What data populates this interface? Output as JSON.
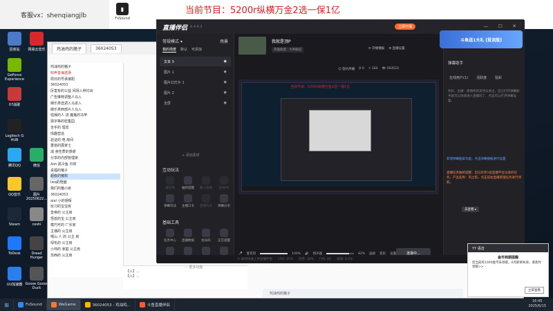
{
  "banner": {
    "wx": "客服vx：shenqiangjlb",
    "fxsound": "FxSound",
    "title": "当前节目：5200r纵横万金2选一保1亿"
  },
  "desktop_icons": [
    {
      "label": "回收站",
      "color": "#4a7ac8"
    },
    {
      "label": "网易云音乐",
      "color": "#d8282c"
    },
    {
      "label": "GeForce Experience",
      "color": "#76b900"
    },
    {
      "label": "07战歌",
      "color": "#c83a3a"
    },
    {
      "label": "Logitech G HUB",
      "color": "#222"
    },
    {
      "label": "腾讯QQ",
      "color": "#2aa8f2"
    },
    {
      "label": "QQ音乐",
      "color": "#f7c72b"
    },
    {
      "label": "Steam",
      "color": "#1b2838"
    },
    {
      "label": "ToDesk",
      "color": "#1e78ff"
    },
    {
      "label": "UU加速器",
      "color": "#2a7ff0"
    },
    {
      "label": "Dread Hunger",
      "color": "#444"
    },
    {
      "label": "Goose Goose Duck",
      "color": "#555"
    },
    {
      "label": "微信",
      "color": "#2aae67"
    },
    {
      "label": "ceshi",
      "color": "#888"
    },
    {
      "label": "图片 20250622...",
      "color": "#666"
    }
  ],
  "browser": {
    "tab1": "鸡油鸡的猪子",
    "tab2": "36024053",
    "tree": [
      {
        "t": "鸡油鸡的猪子",
        "c": ""
      },
      {
        "t": "好声音海选场",
        "c": "red"
      },
      {
        "t": "周日的号承接配",
        "c": ""
      },
      {
        "t": "36024053",
        "c": ""
      },
      {
        "t": "厉害有的公益 闲场入骨均出",
        "c": ""
      },
      {
        "t": "广告推荐调整人马入",
        "c": ""
      },
      {
        "t": "娱乐类选调入马进入",
        "c": ""
      },
      {
        "t": "娱乐类西部片人马入",
        "c": ""
      },
      {
        "t": "枯燥的人 进  魔鬼的马甲",
        "c": ""
      },
      {
        "t": "猜字等的密集园",
        "c": ""
      },
      {
        "t": "吉手的 理发",
        "c": ""
      },
      {
        "t": "情趣营造",
        "c": ""
      },
      {
        "t": "验证的 电 房间",
        "c": ""
      },
      {
        "t": "重拾的展家士",
        "c": ""
      },
      {
        "t": "减 食性质的感谢",
        "c": ""
      },
      {
        "t": "分享的内部管理家",
        "c": ""
      },
      {
        "t": "Ash 孤冷鱼 日常",
        "c": ""
      },
      {
        "t": "桌福的猪子",
        "c": ""
      },
      {
        "t": "超级的猪狗",
        "c": "sel"
      },
      {
        "t": "Iwq的陪面",
        "c": ""
      },
      {
        "t": "我们的猪小房",
        "c": ""
      },
      {
        "t": "36024053",
        "c": ""
      },
      {
        "t": "alal 小的钥辉",
        "c": ""
      },
      {
        "t": "玩习的宝宝房",
        "c": ""
      },
      {
        "t": "皇帝的 公主房",
        "c": ""
      },
      {
        "t": "怪兽的宝 公主房",
        "c": ""
      },
      {
        "t": "模巧可的 厂长家",
        "c": ""
      },
      {
        "t": "主播的 公主房",
        "c": ""
      },
      {
        "t": "噶山 人 的 公主 房",
        "c": ""
      },
      {
        "t": "绿毛的 公主房",
        "c": ""
      },
      {
        "t": "小帅的 家庭 公主房",
        "c": ""
      },
      {
        "t": "苏西的 公主房",
        "c": ""
      }
    ],
    "chat_lines": [
      "【入】...",
      "【入】..."
    ],
    "bottom": "鸡油鸡的猪子"
  },
  "app": {
    "logo": "直播伴侣",
    "version": "6.4.4.2",
    "official": "立即开播",
    "controls": "— ☐ ✕",
    "mode": "常规模式 ▾",
    "mode_right": "场景",
    "scene_tabs": [
      "我的场景",
      "默认",
      "可添加"
    ],
    "sources": [
      {
        "name": "文本 3",
        "sel": true
      },
      {
        "name": "图片 1",
        "sel": false
      },
      {
        "name": "图片幻灯片 1",
        "sel": false
      },
      {
        "name": "图片 2",
        "sel": false
      },
      {
        "name": "全屏",
        "sel": false
      }
    ],
    "add_source": "+ 添加素材",
    "interact_title": "互动玩法",
    "interact_tools": [
      {
        "l": "送礼物",
        "dim": true
      },
      {
        "l": "抽奖提醒",
        "dim": false
      },
      {
        "l": "截人观看",
        "dim": true
      },
      {
        "l": "连线PK",
        "dim": true
      },
      {
        "l": "弹幕玩法",
        "dim": false
      },
      {
        "l": "主播口令",
        "dim": false
      },
      {
        "l": "直播玩法",
        "dim": true
      },
      {
        "l": "弹幕分享",
        "dim": false
      }
    ],
    "basic_title": "基础工具",
    "basic_tools": [
      {
        "l": "任务中心",
        "dim": false
      },
      {
        "l": "直播数据",
        "dim": false
      },
      {
        "l": "会员码",
        "dim": false
      },
      {
        "l": "正在提醒",
        "dim": false
      },
      {
        "l": "弹幕屏",
        "dim": false
      },
      {
        "l": "直播设置",
        "dim": false
      },
      {
        "l": "房管辅助",
        "dim": false
      },
      {
        "l": "下播分析",
        "dim": false
      }
    ],
    "more_tools": "··· 更多功能",
    "room": {
      "name": "我就是顶P",
      "category": "英雄联盟 · 大神解说",
      "btn1": "⟳ 开播播报",
      "btn2": "⚙ 直播设置",
      "stats": [
        "☺ 签约月播",
        "♀ 0",
        "⇧ 164",
        "👁 593523"
      ]
    },
    "preview_banner": "当前节目：5200r纵横万金2选一保1亿",
    "mic_label": "麦克风",
    "mic_value": "100%",
    "speaker_label": "扬声器",
    "speaker_value": "82%",
    "mic_fill": 1.0,
    "speaker_fill": 0.82,
    "extra_icons": [
      "画质",
      "变形",
      "设置"
    ],
    "go_live": "连接中...",
    "status": [
      "⓪ 如何快速上手直播伴侣",
      "CPU: 25%",
      "内存: 38%",
      "FPS: 60",
      "丢帧: 0.0%"
    ],
    "right": {
      "title": "弹幕助手",
      "tabs": [
        "在线用户(1)",
        "活跃度",
        "贴彩"
      ],
      "text1": "你好，主播：感谢你的支持与关注，自己打开弹幕助手就可以快速进入直播间了，点击可以打开弹幕设置。",
      "notice1": "新增弹幕截屏功能，点击弹幕播报进行设置",
      "notice2": "直播任务抽奖提醒：您已有奖1张直播平台派发的任务，产品名称：风之箭，点击前往直播管理任务进行领取。",
      "go_see": "去查看 ▸"
    }
  },
  "ad": "斗鱼送1大礼 [投流版]",
  "popup": {
    "header": "YY 语音",
    "title": "金币到期提醒",
    "body": "您当前有1000金币未领取，0点即将失效，请及时领取>>",
    "button": "立即查看"
  },
  "taskbar": {
    "items": [
      {
        "label": "FxSound",
        "color": "#2a8cff",
        "active": false
      },
      {
        "label": "WeGame",
        "color": "#ff7a20",
        "active": true
      },
      {
        "label": "36024053 - 鸡油鸡...",
        "color": "#ffb400",
        "active": false
      },
      {
        "label": "斗鱼直播伴侣",
        "color": "#ff5a2a",
        "active": false
      }
    ],
    "time": "16:45",
    "date": "2025/6/15"
  }
}
